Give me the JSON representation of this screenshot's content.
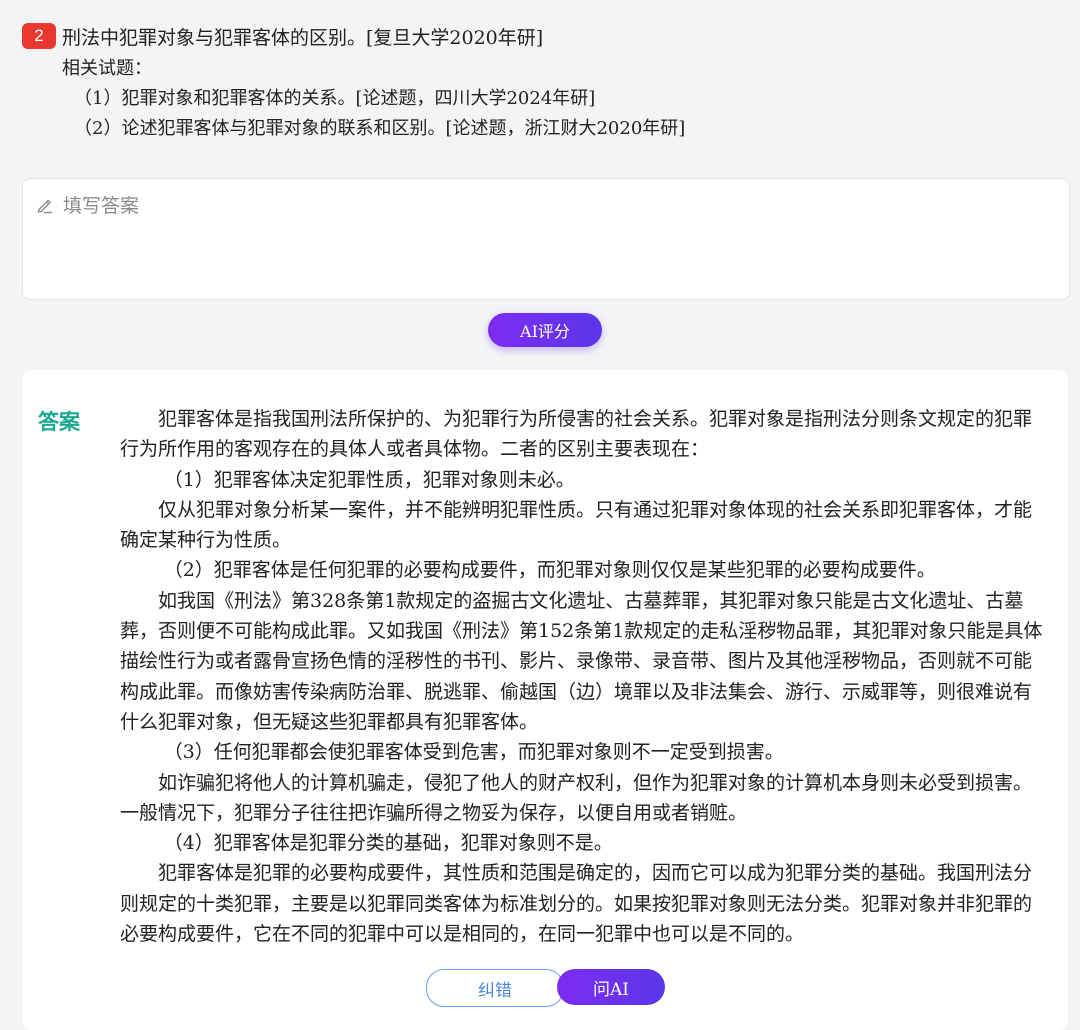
{
  "question": {
    "number": "2",
    "title": "刑法中犯罪对象与犯罪客体的区别。[复旦大学2020年研]",
    "related_title": "相关试题：",
    "related": [
      "（1）犯罪对象和犯罪客体的关系。[论述题，四川大学2024年研]",
      "（2）论述犯罪客体与犯罪对象的联系和区别。[论述题，浙江财大2020年研]"
    ]
  },
  "answer_input": {
    "placeholder": "填写答案",
    "icon": "pencil-icon"
  },
  "ai_score_button": "AI评分",
  "answer": {
    "label": "答案",
    "paragraphs": [
      "犯罪客体是指我国刑法所保护的、为犯罪行为所侵害的社会关系。犯罪对象是指刑法分则条文规定的犯罪行为所作用的客观存在的具体人或者具体物。二者的区别主要表现在：",
      "（1）犯罪客体决定犯罪性质，犯罪对象则未必。",
      "仅从犯罪对象分析某一案件，并不能辨明犯罪性质。只有通过犯罪对象体现的社会关系即犯罪客体，才能确定某种行为性质。",
      "（2）犯罪客体是任何犯罪的必要构成要件，而犯罪对象则仅仅是某些犯罪的必要构成要件。",
      "如我国《刑法》第328条第1款规定的盗掘古文化遗址、古墓葬罪，其犯罪对象只能是古文化遗址、古墓葬，否则便不可能构成此罪。又如我国《刑法》第152条第1款规定的走私淫秽物品罪，其犯罪对象只能是具体描绘性行为或者露骨宣扬色情的淫秽性的书刊、影片、录像带、录音带、图片及其他淫秽物品，否则就不可能构成此罪。而像妨害传染病防治罪、脱逃罪、偷越国（边）境罪以及非法集会、游行、示威罪等，则很难说有什么犯罪对象，但无疑这些犯罪都具有犯罪客体。",
      "（3）任何犯罪都会使犯罪客体受到危害，而犯罪对象则不一定受到损害。",
      "如诈骗犯将他人的计算机骗走，侵犯了他人的财产权利，但作为犯罪对象的计算机本身则未必受到损害。一般情况下，犯罪分子往往把诈骗所得之物妥为保存，以便自用或者销赃。",
      "（4）犯罪客体是犯罪分类的基础，犯罪对象则不是。",
      "犯罪客体是犯罪的必要构成要件，其性质和范围是确定的，因而它可以成为犯罪分类的基础。我国刑法分则规定的十类犯罪，主要是以犯罪同类客体为标准划分的。如果按犯罪对象则无法分类。犯罪对象并非犯罪的必要构成要件，它在不同的犯罪中可以是相同的，在同一犯罪中也可以是不同的。"
    ]
  },
  "buttons": {
    "correct": "纠错",
    "ask_ai": "问AI"
  },
  "colors": {
    "badge": "#e8382f",
    "answer_label": "#1aa88f",
    "purple_button": "#6a32ee",
    "outline_button": "#4a86dd"
  }
}
